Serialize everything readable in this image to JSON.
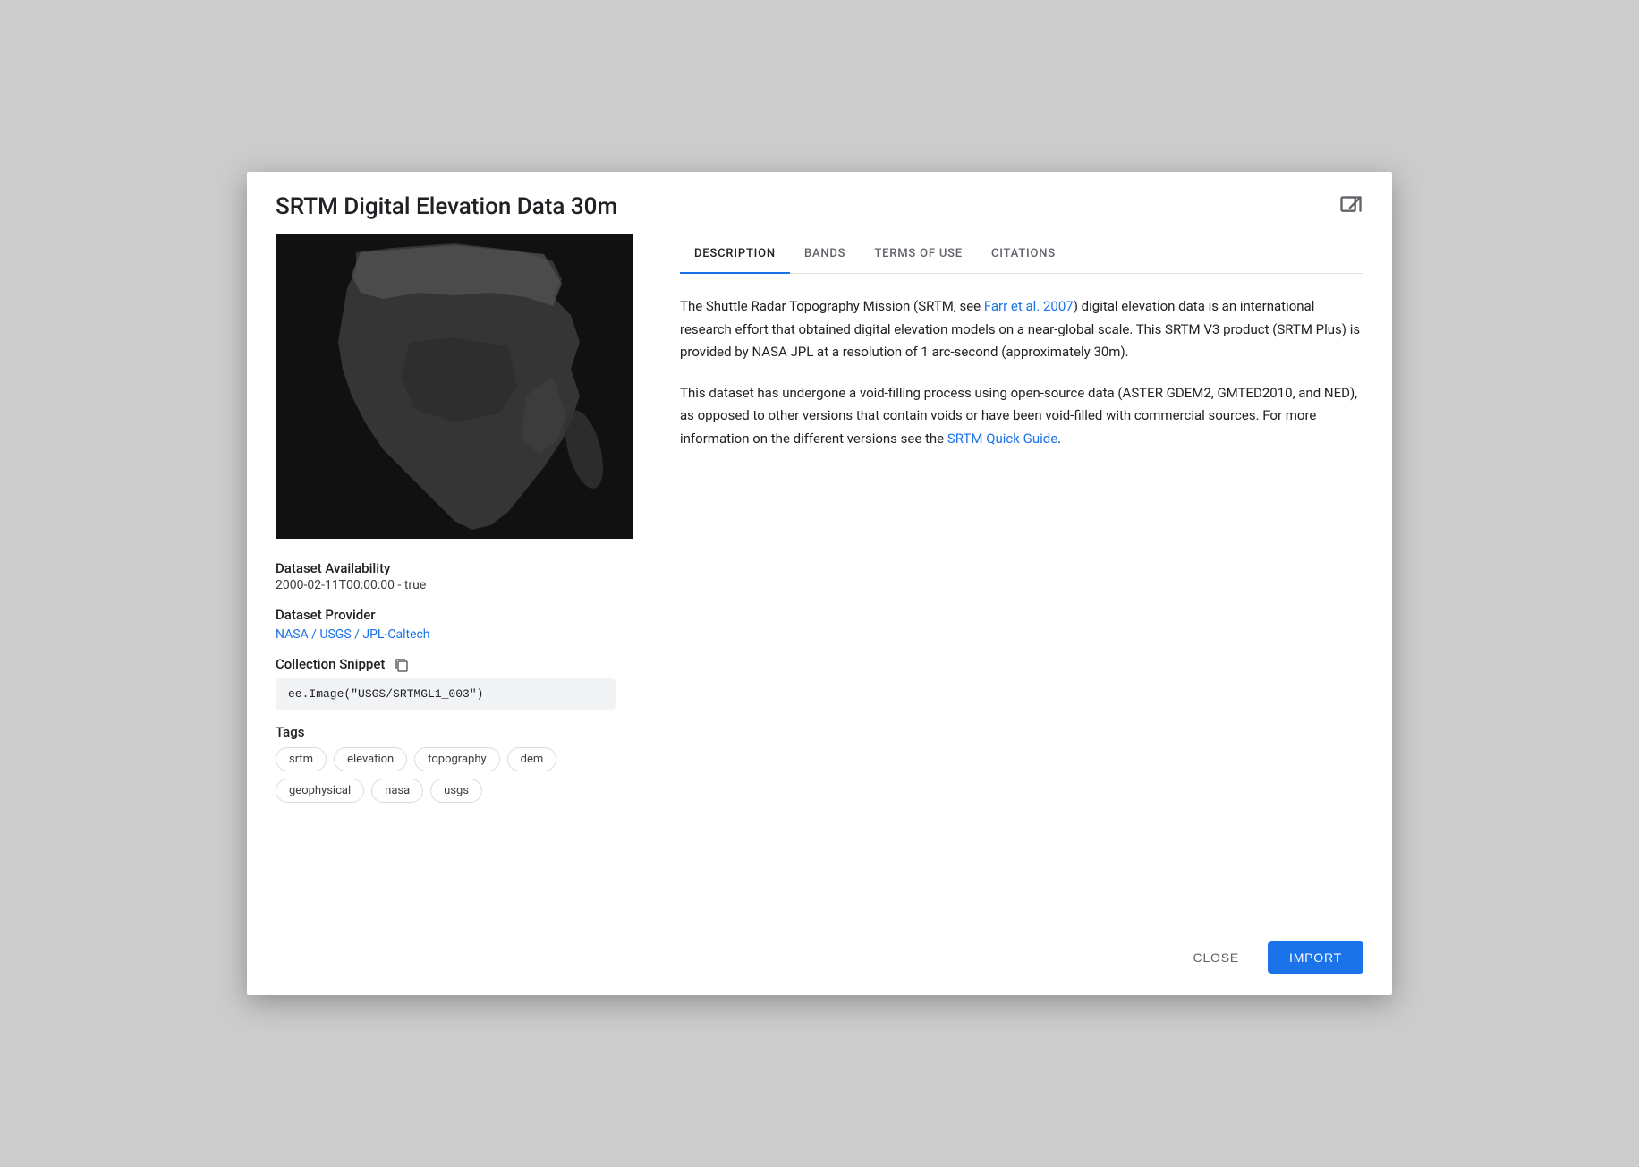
{
  "dialog": {
    "title": "SRTM Digital Elevation Data 30m",
    "external_link_label": "Open in new tab"
  },
  "tabs": [
    {
      "id": "description",
      "label": "DESCRIPTION",
      "active": true
    },
    {
      "id": "bands",
      "label": "BANDS",
      "active": false
    },
    {
      "id": "terms",
      "label": "TERMS OF USE",
      "active": false
    },
    {
      "id": "citations",
      "label": "CITATIONS",
      "active": false
    }
  ],
  "description": {
    "paragraph1_before_link": "The Shuttle Radar Topography Mission (SRTM, see ",
    "paragraph1_link_text": "Farr et al. 2007",
    "paragraph1_after_link": ") digital elevation data is an international research effort that obtained digital elevation models on a near-global scale. This SRTM V3 product (SRTM Plus) is provided by NASA JPL at a resolution of 1 arc-second (approximately 30m).",
    "paragraph2_before_link": "This dataset has undergone a void-filling process using open-source data (ASTER GDEM2, GMTED2010, and NED), as opposed to other versions that contain voids or have been void-filled with commercial sources. For more information on the different versions see the ",
    "paragraph2_link_text": "SRTM Quick Guide",
    "paragraph2_after_link": "."
  },
  "metadata": {
    "availability_label": "Dataset Availability",
    "availability_value": "2000-02-11T00:00:00 - true",
    "provider_label": "Dataset Provider",
    "provider_link_text": "NASA / USGS / JPL-Caltech",
    "snippet_label": "Collection Snippet",
    "snippet_value": "ee.Image(\"USGS/SRTMGL1_003\")",
    "tags_label": "Tags",
    "tags": [
      {
        "label": "srtm"
      },
      {
        "label": "elevation"
      },
      {
        "label": "topography"
      },
      {
        "label": "dem"
      },
      {
        "label": "geophysical"
      },
      {
        "label": "nasa"
      },
      {
        "label": "usgs"
      }
    ]
  },
  "footer": {
    "close_label": "CLOSE",
    "import_label": "IMPORT"
  }
}
